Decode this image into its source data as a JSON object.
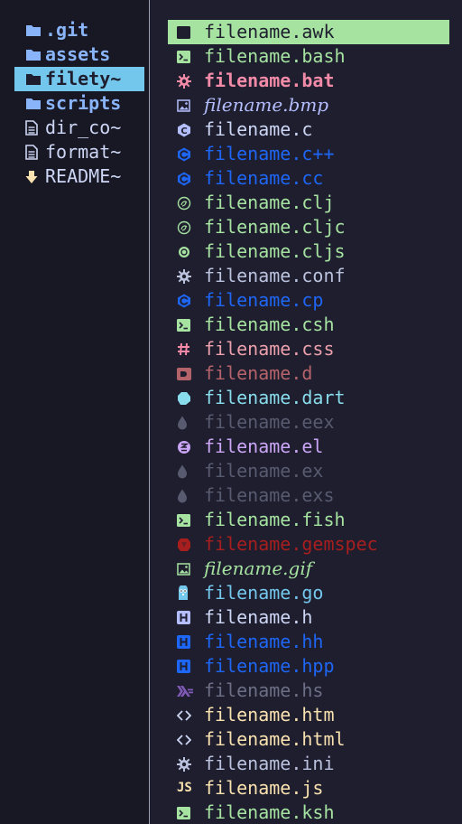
{
  "left_pane": {
    "items": [
      {
        "label": ".git",
        "kind": "dir",
        "icon": "folder-icon",
        "selected": false
      },
      {
        "label": "assets",
        "kind": "dir",
        "icon": "folder-icon",
        "selected": false
      },
      {
        "label": "filety~",
        "kind": "dir",
        "icon": "folder-icon",
        "selected": true
      },
      {
        "label": "scripts",
        "kind": "dir",
        "icon": "folder-icon",
        "selected": false
      },
      {
        "label": "dir_co~",
        "kind": "file",
        "icon": "document-icon",
        "selected": false
      },
      {
        "label": "format~",
        "kind": "file",
        "icon": "document-icon",
        "selected": false
      },
      {
        "label": "README~",
        "kind": "file",
        "icon": "download-arrow-icon",
        "selected": false
      }
    ]
  },
  "right_pane": {
    "items": [
      {
        "label": "filename.awk",
        "icon": "terminal-icon",
        "color": "#1e1e2e",
        "icon_color": "#1e1e2e",
        "selected": true
      },
      {
        "label": "filename.bash",
        "icon": "terminal-icon",
        "color": "#a6e3a1",
        "icon_color": "#a6e3a1"
      },
      {
        "label": "filename.bat",
        "icon": "gear-icon",
        "color": "#f38ba8",
        "icon_color": "#f38ba8",
        "bold": true
      },
      {
        "label": "filename.bmp",
        "icon": "image-icon",
        "color": "#b4befe",
        "icon_color": "#b4befe",
        "italic": true
      },
      {
        "label": "filename.c",
        "icon": "c-lang-icon",
        "color": "#cdd6f4",
        "icon_color": "#b4befe"
      },
      {
        "label": "filename.c++",
        "icon": "cpp-lang-icon",
        "color": "#1e66f5",
        "icon_color": "#1e66f5"
      },
      {
        "label": "filename.cc",
        "icon": "cpp-lang-icon",
        "color": "#1e66f5",
        "icon_color": "#1e66f5"
      },
      {
        "label": "filename.clj",
        "icon": "clojure-icon",
        "color": "#a6e3a1",
        "icon_color": "#a6e3a1"
      },
      {
        "label": "filename.cljc",
        "icon": "clojure-icon",
        "color": "#a6e3a1",
        "icon_color": "#a6e3a1"
      },
      {
        "label": "filename.cljs",
        "icon": "clojurescript-icon",
        "color": "#a6e3a1",
        "icon_color": "#a6e3a1"
      },
      {
        "label": "filename.conf",
        "icon": "gear-icon",
        "color": "#bac2de",
        "icon_color": "#bac2de"
      },
      {
        "label": "filename.cp",
        "icon": "cpp-lang-icon",
        "color": "#1e66f5",
        "icon_color": "#1e66f5"
      },
      {
        "label": "filename.csh",
        "icon": "terminal-icon",
        "color": "#a6e3a1",
        "icon_color": "#a6e3a1"
      },
      {
        "label": "filename.css",
        "icon": "hash-icon",
        "color": "#eba0ac",
        "icon_color": "#f38ba8"
      },
      {
        "label": "filename.d",
        "icon": "d-lang-icon",
        "color": "#b4636a",
        "icon_color": "#b4636a"
      },
      {
        "label": "filename.dart",
        "icon": "dart-icon",
        "color": "#89dceb",
        "icon_color": "#89dceb"
      },
      {
        "label": "filename.eex",
        "icon": "elixir-drop-icon",
        "color": "#585b70",
        "icon_color": "#585b70"
      },
      {
        "label": "filename.el",
        "icon": "emacs-icon",
        "color": "#cba6f7",
        "icon_color": "#cba6f7"
      },
      {
        "label": "filename.ex",
        "icon": "elixir-drop-icon",
        "color": "#585b70",
        "icon_color": "#585b70"
      },
      {
        "label": "filename.exs",
        "icon": "elixir-drop-icon",
        "color": "#585b70",
        "icon_color": "#585b70"
      },
      {
        "label": "filename.fish",
        "icon": "terminal-icon",
        "color": "#a6e3a1",
        "icon_color": "#a6e3a1"
      },
      {
        "label": "filename.gemspec",
        "icon": "ruby-gem-icon",
        "color": "#a61e1e",
        "icon_color": "#a61e1e"
      },
      {
        "label": "filename.gif",
        "icon": "image-icon",
        "color": "#a6e3a1",
        "icon_color": "#a6e3a1",
        "italic": true
      },
      {
        "label": "filename.go",
        "icon": "gopher-icon",
        "color": "#74c7ec",
        "icon_color": "#74c7ec"
      },
      {
        "label": "filename.h",
        "icon": "header-h-icon",
        "color": "#cdd6f4",
        "icon_color": "#b4befe"
      },
      {
        "label": "filename.hh",
        "icon": "header-h-icon",
        "color": "#1e66f5",
        "icon_color": "#1e66f5"
      },
      {
        "label": "filename.hpp",
        "icon": "header-h-icon",
        "color": "#1e66f5",
        "icon_color": "#1e66f5"
      },
      {
        "label": "filename.hs",
        "icon": "haskell-icon",
        "color": "#6c6f85",
        "icon_color": "#7f5ab6"
      },
      {
        "label": "filename.htm",
        "icon": "code-brackets-icon",
        "color": "#f9e2af",
        "icon_color": "#cdd6f4"
      },
      {
        "label": "filename.html",
        "icon": "code-brackets-icon",
        "color": "#f9e2af",
        "icon_color": "#cdd6f4"
      },
      {
        "label": "filename.ini",
        "icon": "gear-icon",
        "color": "#bac2de",
        "icon_color": "#bac2de"
      },
      {
        "label": "filename.js",
        "icon": "javascript-icon",
        "color": "#f9e2af",
        "icon_color": "#f9e2af"
      },
      {
        "label": "filename.ksh",
        "icon": "terminal-icon",
        "color": "#a6e3a1",
        "icon_color": "#a6e3a1"
      }
    ]
  }
}
